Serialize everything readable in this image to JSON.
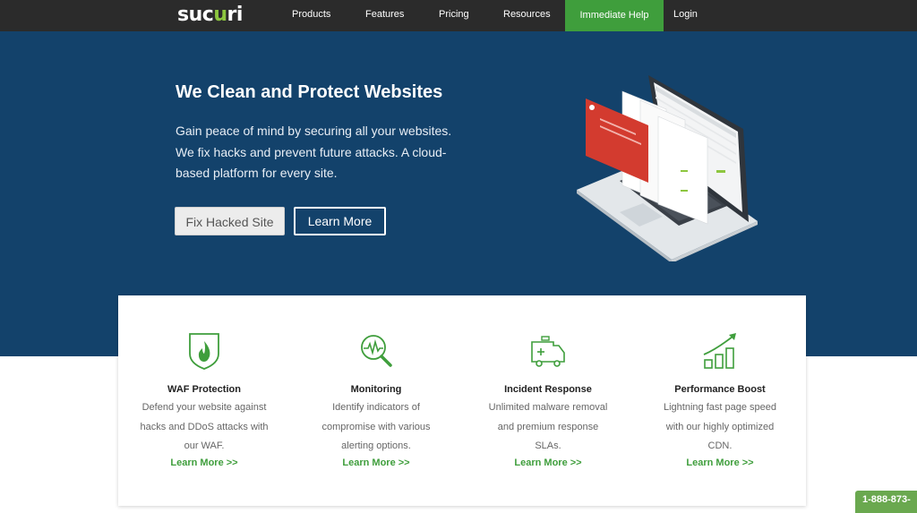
{
  "header": {
    "logo": {
      "part1": "suc",
      "part2": "u",
      "part3": "ri"
    },
    "nav": [
      {
        "label": "Products"
      },
      {
        "label": "Features"
      },
      {
        "label": "Pricing"
      },
      {
        "label": "Resources"
      }
    ],
    "help_label": "Immediate Help",
    "login_label": "Login"
  },
  "hero": {
    "title": "We Clean and Protect Websites",
    "description": "Gain peace of mind by securing all your websites. We fix hacks and prevent future attacks. A cloud-based platform for every site.",
    "fix_button": "Fix Hacked Site",
    "learn_button": "Learn More",
    "illustration": "laptop-dashboard-illustration"
  },
  "features": [
    {
      "icon": "shield-fire-icon",
      "title": "WAF Protection",
      "description": "Defend your website against hacks and DDoS attacks with our WAF.",
      "link": "Learn More >>"
    },
    {
      "icon": "magnifier-pulse-icon",
      "title": "Monitoring",
      "description": "Identify indicators of compromise with various alerting options.",
      "link": "Learn More >>"
    },
    {
      "icon": "ambulance-icon",
      "title": "Incident Response",
      "description": "Unlimited malware removal and premium response SLAs.",
      "link": "Learn More >>"
    },
    {
      "icon": "growth-chart-icon",
      "title": "Performance Boost",
      "description": "Lightning fast page speed with our highly optimized CDN.",
      "link": "Learn More >>"
    }
  ],
  "phone_badge": "1-888-873-",
  "colors": {
    "topbar": "#2b2b2b",
    "hero": "#13426b",
    "accent_green": "#3f9e3c",
    "help_button": "#3f9e3c",
    "alert_red": "#d33b2f"
  }
}
